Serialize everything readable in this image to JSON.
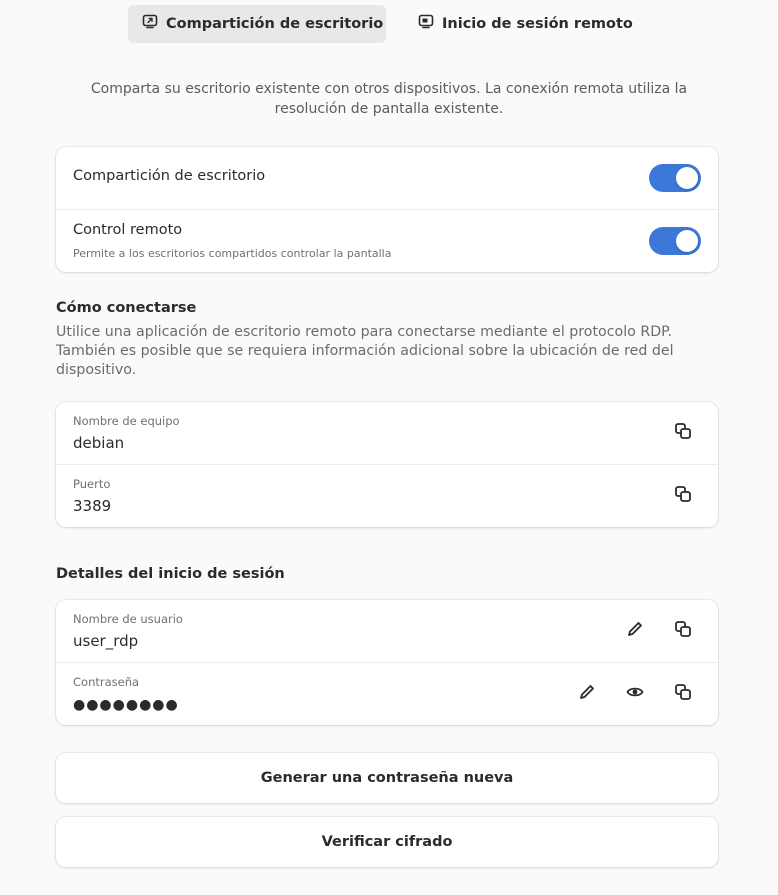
{
  "tabs": [
    {
      "label": "Compartición de escritorio",
      "icon": "screen-share-icon"
    },
    {
      "label": "Inicio de sesión remoto",
      "icon": "remote-desktop-icon"
    }
  ],
  "intro": "Comparta su escritorio existente con otros dispositivos. La conexión remota utiliza la resolución de pantalla existente.",
  "sharing": {
    "desktop_sharing": {
      "label": "Compartición de escritorio",
      "enabled": true
    },
    "remote_control": {
      "label": "Control remoto",
      "subtitle": "Permite a los escritorios compartidos controlar la pantalla",
      "enabled": true
    }
  },
  "connect": {
    "title": "Cómo conectarse",
    "description": "Utilice una aplicación de escritorio remoto para conectarse mediante el protocolo RDP. También es posible que se requiera información adicional sobre la ubicación de red del dispositivo.",
    "hostname": {
      "label": "Nombre de equipo",
      "value": "debian"
    },
    "port": {
      "label": "Puerto",
      "value": "3389"
    }
  },
  "login": {
    "title": "Detalles del inicio de sesión",
    "username": {
      "label": "Nombre de usuario",
      "value": "user_rdp"
    },
    "password": {
      "label": "Contraseña",
      "value": "●●●●●●●●"
    }
  },
  "buttons": {
    "generate_password": "Generar una contraseña nueva",
    "verify_encryption": "Verificar cifrado"
  },
  "colors": {
    "accent": "#3b78d8",
    "background": "#fafafa"
  }
}
